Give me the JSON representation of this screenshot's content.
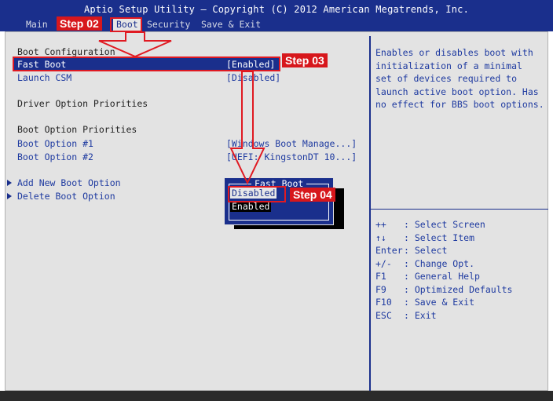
{
  "header": {
    "title": "Aptio Setup Utility – Copyright (C) 2012 American Megatrends, Inc.",
    "menu": [
      {
        "label": "Main",
        "active": false
      },
      {
        "label": "Boot",
        "active": true
      },
      {
        "label": "Security",
        "active": false
      },
      {
        "label": "Save & Exit",
        "active": false
      }
    ]
  },
  "left_panel": {
    "section_boot_configuration": "Boot Configuration",
    "fast_boot": {
      "label": "Fast Boot",
      "value": "[Enabled]"
    },
    "launch_csm": {
      "label": "Launch CSM",
      "value": "[Disabled]"
    },
    "section_driver_option_priorities": "Driver Option Priorities",
    "section_boot_option_priorities": "Boot Option Priorities",
    "boot_option_1": {
      "label": "Boot Option #1",
      "value": "[Windows Boot Manage...]"
    },
    "boot_option_2": {
      "label": "Boot Option #2",
      "value": "[UEFI: KingstonDT 10...]"
    },
    "add_new_boot_option": "Add New Boot Option",
    "delete_boot_option": "Delete Boot Option"
  },
  "popup": {
    "title": "Fast Boot",
    "options": [
      "Disabled",
      "Enabled"
    ],
    "selected": "Disabled"
  },
  "help_panel": {
    "description": "Enables or disables boot with\ninitialization of a minimal\nset of devices required to\nlaunch active boot option. Has\nno effect for BBS boot options.",
    "keys": [
      {
        "key": "++",
        "desc": ": Select Screen"
      },
      {
        "key": "↑↓",
        "desc": ": Select Item"
      },
      {
        "key": "Enter",
        "desc": ": Select"
      },
      {
        "key": "+/-",
        "desc": ": Change Opt."
      },
      {
        "key": "F1",
        "desc": ": General Help"
      },
      {
        "key": "F9",
        "desc": ": Optimized Defaults"
      },
      {
        "key": "F10",
        "desc": ": Save & Exit"
      },
      {
        "key": "ESC",
        "desc": ": Exit"
      }
    ]
  },
  "annotations": {
    "step02": "Step 02",
    "step03": "Step 03",
    "step04": "Step 04"
  },
  "colors": {
    "bios_blue": "#1a2f8c",
    "panel_gray": "#e3e3e3",
    "annotation_red": "#e01a22"
  }
}
